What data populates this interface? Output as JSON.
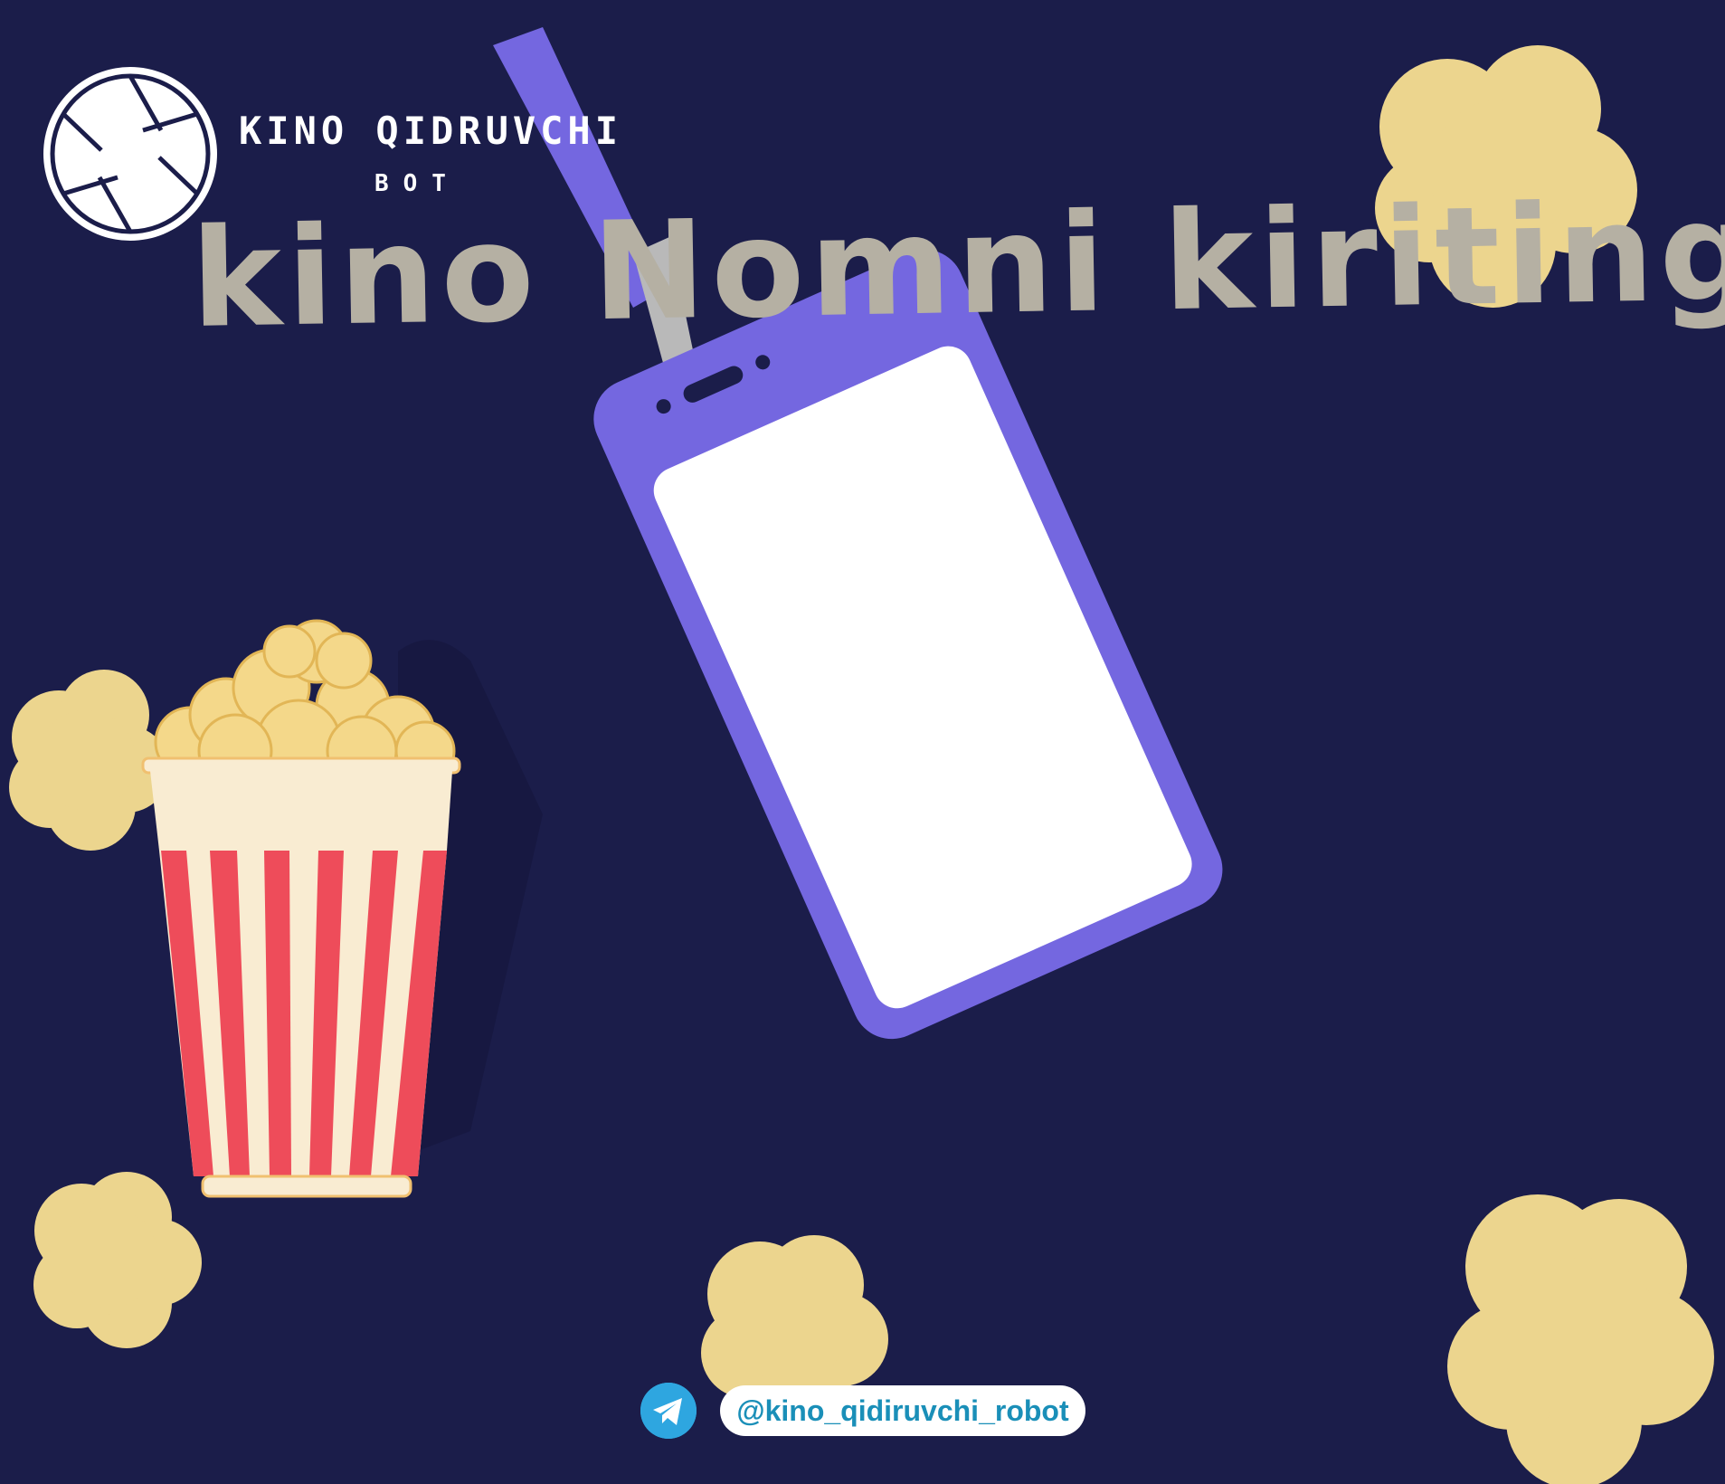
{
  "brand": {
    "name": "KINO QIDRUVCHI",
    "subtitle": "BOT",
    "logo_icon": "camera-aperture-icon"
  },
  "headline": "kino Nomni kiriting",
  "footer": {
    "icon": "telegram-icon",
    "handle": "@kino_qidiruvchi_robot"
  },
  "colors": {
    "background": "#1b1d4a",
    "headline": "#b5b0a3",
    "badge": "#7467e0",
    "popcorn": "#ecd58e",
    "stripe_red": "#ee4c5a",
    "stripe_cream": "#f9ecd2",
    "handle_text": "#1a8fb8",
    "telegram": "#2ea6e0"
  }
}
